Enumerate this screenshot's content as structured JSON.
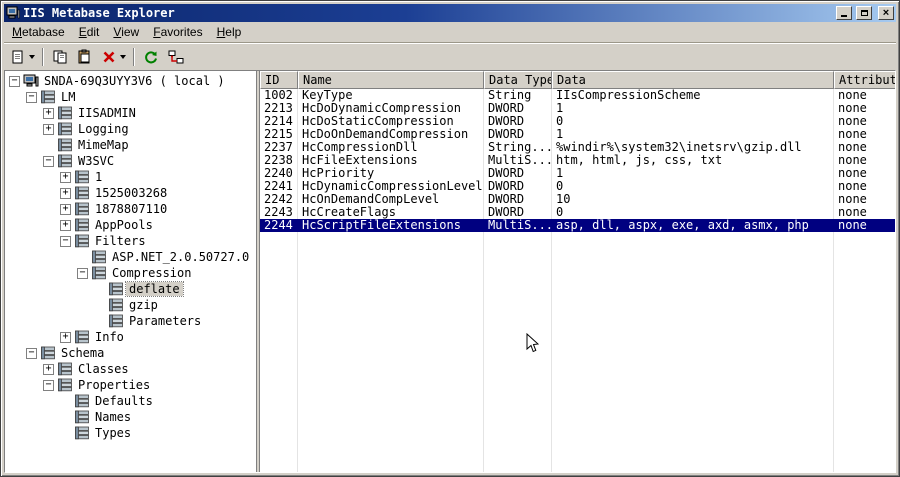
{
  "window": {
    "title": "IIS Metabase Explorer"
  },
  "menu": {
    "items": [
      {
        "label": "Metabase",
        "key": "M"
      },
      {
        "label": "Edit",
        "key": "E"
      },
      {
        "label": "View",
        "key": "V"
      },
      {
        "label": "Favorites",
        "key": "F"
      },
      {
        "label": "Help",
        "key": "H"
      }
    ]
  },
  "toolbar": {
    "buttons": [
      {
        "id": "new-record",
        "icon": "new-record-icon",
        "dropdown": true,
        "group_end": true
      },
      {
        "id": "copy",
        "icon": "copy-icon"
      },
      {
        "id": "paste",
        "icon": "paste-icon"
      },
      {
        "id": "delete",
        "icon": "delete-icon",
        "dropdown": true,
        "group_end": true
      },
      {
        "id": "refresh",
        "icon": "refresh-icon"
      },
      {
        "id": "connect",
        "icon": "connect-icon"
      }
    ]
  },
  "tree": {
    "nodes": [
      {
        "label": "SNDA-69Q3UYY3V6 ( local )",
        "depth": 0,
        "expander": "minus",
        "icon": "computer-icon",
        "selected": false
      },
      {
        "label": "LM",
        "depth": 1,
        "expander": "minus",
        "icon": "record-stack-icon",
        "selected": false
      },
      {
        "label": "IISADMIN",
        "depth": 2,
        "expander": "plus",
        "icon": "record-stack-icon",
        "selected": false
      },
      {
        "label": "Logging",
        "depth": 2,
        "expander": "plus",
        "icon": "record-stack-icon",
        "selected": false
      },
      {
        "label": "MimeMap",
        "depth": 2,
        "expander": "none",
        "icon": "record-stack-icon",
        "selected": false
      },
      {
        "label": "W3SVC",
        "depth": 2,
        "expander": "minus",
        "icon": "record-stack-icon",
        "selected": false
      },
      {
        "label": "1",
        "depth": 3,
        "expander": "plus",
        "icon": "record-stack-icon",
        "selected": false
      },
      {
        "label": "1525003268",
        "depth": 3,
        "expander": "plus",
        "icon": "record-stack-icon",
        "selected": false
      },
      {
        "label": "1878807110",
        "depth": 3,
        "expander": "plus",
        "icon": "record-stack-icon",
        "selected": false
      },
      {
        "label": "AppPools",
        "depth": 3,
        "expander": "plus",
        "icon": "record-stack-icon",
        "selected": false
      },
      {
        "label": "Filters",
        "depth": 3,
        "expander": "minus",
        "icon": "record-stack-icon",
        "selected": false
      },
      {
        "label": "ASP.NET_2.0.50727.0",
        "depth": 4,
        "expander": "none",
        "icon": "record-stack-icon",
        "selected": false
      },
      {
        "label": "Compression",
        "depth": 4,
        "expander": "minus",
        "icon": "record-stack-icon",
        "selected": false
      },
      {
        "label": "deflate",
        "depth": 5,
        "expander": "none",
        "icon": "record-stack-icon",
        "selected": true
      },
      {
        "label": "gzip",
        "depth": 5,
        "expander": "none",
        "icon": "record-stack-icon",
        "selected": false
      },
      {
        "label": "Parameters",
        "depth": 5,
        "expander": "none",
        "icon": "record-stack-icon",
        "selected": false
      },
      {
        "label": "Info",
        "depth": 3,
        "expander": "plus",
        "icon": "record-stack-icon",
        "selected": false
      },
      {
        "label": "Schema",
        "depth": 1,
        "expander": "minus",
        "icon": "record-stack-icon",
        "selected": false
      },
      {
        "label": "Classes",
        "depth": 2,
        "expander": "plus",
        "icon": "record-stack-icon",
        "selected": false
      },
      {
        "label": "Properties",
        "depth": 2,
        "expander": "minus",
        "icon": "record-stack-icon",
        "selected": false
      },
      {
        "label": "Defaults",
        "depth": 3,
        "expander": "none",
        "icon": "record-stack-icon",
        "selected": false
      },
      {
        "label": "Names",
        "depth": 3,
        "expander": "none",
        "icon": "record-stack-icon",
        "selected": false
      },
      {
        "label": "Types",
        "depth": 3,
        "expander": "none",
        "icon": "record-stack-icon",
        "selected": false
      }
    ]
  },
  "table": {
    "columns": [
      "ID",
      "Name",
      "Data Type",
      "Data",
      "Attributes"
    ],
    "selected_row": 10,
    "rows": [
      [
        "1002",
        "KeyType",
        "String",
        "IIsCompressionScheme",
        "none"
      ],
      [
        "2213",
        "HcDoDynamicCompression",
        "DWORD",
        "1",
        "none"
      ],
      [
        "2214",
        "HcDoStaticCompression",
        "DWORD",
        "0",
        "none"
      ],
      [
        "2215",
        "HcDoOnDemandCompression",
        "DWORD",
        "1",
        "none"
      ],
      [
        "2237",
        "HcCompressionDll",
        "String...",
        "%windir%\\system32\\inetsrv\\gzip.dll",
        "none"
      ],
      [
        "2238",
        "HcFileExtensions",
        "MultiS...",
        "htm, html, js, css, txt",
        "none"
      ],
      [
        "2240",
        "HcPriority",
        "DWORD",
        "1",
        "none"
      ],
      [
        "2241",
        "HcDynamicCompressionLevel",
        "DWORD",
        "0",
        "none"
      ],
      [
        "2242",
        "HcOnDemandCompLevel",
        "DWORD",
        "10",
        "none"
      ],
      [
        "2243",
        "HcCreateFlags",
        "DWORD",
        "0",
        "none"
      ],
      [
        "2244",
        "HcScriptFileExtensions",
        "MultiS...",
        "asp, dll, aspx, exe, axd, asmx, php",
        "none"
      ]
    ]
  }
}
